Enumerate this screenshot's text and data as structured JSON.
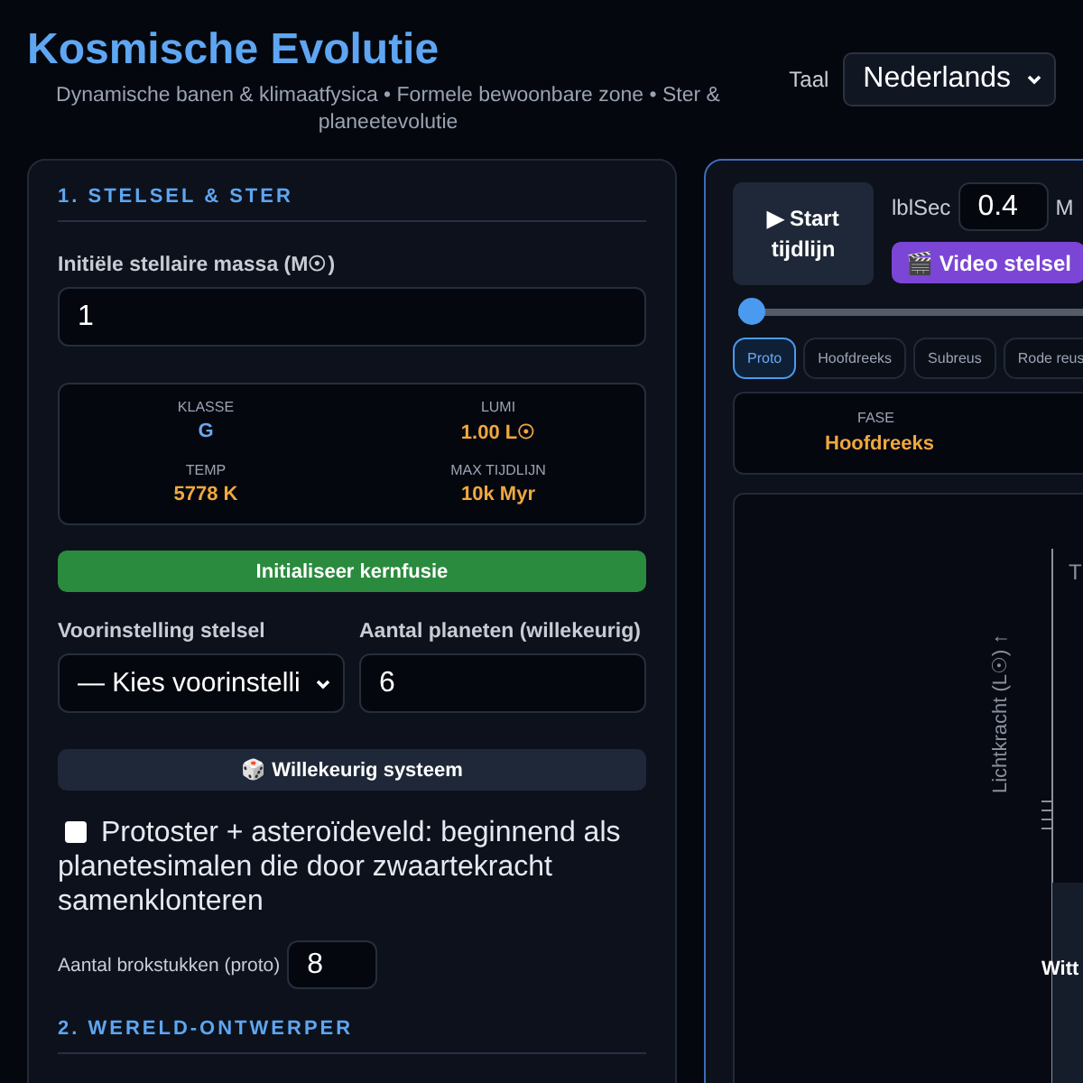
{
  "header": {
    "title": "Kosmische Evolutie",
    "subtitle": "Dynamische banen & klimaatfysica • Formele bewoonbare zone • Ster & planeetevolutie",
    "language": {
      "label": "Taal",
      "value": "Nederlands"
    }
  },
  "left_panel": {
    "section_1": "1. STELSEL & STER",
    "mass": {
      "label": "Initiële stellaire massa (M☉)",
      "value": "1"
    },
    "stats": [
      {
        "label": "KLASSE",
        "value": "G",
        "color": "#6aa8f0"
      },
      {
        "label": "LUMI",
        "value": "1.00 L☉",
        "color": "#f0a840"
      },
      {
        "label": "TEMP",
        "value": "5778 K",
        "color": "#f0a840"
      },
      {
        "label": "MAX TIJDLIJN",
        "value": "10k Myr",
        "color": "#f0a840"
      }
    ],
    "ignite_button": "Initialiseer kernfusie",
    "preset": {
      "label": "Voorinstelling stelsel",
      "value": "— Kies voorinstelli"
    },
    "planet_count": {
      "label": "Aantal planeten (willekeurig)",
      "value": "6"
    },
    "random_button": "🎲 Willekeurig systeem",
    "protostar": {
      "label": "Protoster + asteroïdeveld: beginnend als planetesimalen die door zwaartekracht samenklonteren",
      "checked": false
    },
    "fragments": {
      "label": "Aantal brokstukken (proto)",
      "value": "8"
    },
    "section_2": "2. WERELD-ONTWERPER"
  },
  "right_panel": {
    "start_button": "▶ Start tijdlijn",
    "speed": {
      "label": "lblSec",
      "value": "0.4"
    },
    "cut_label": "M",
    "video_button": "🎬 Video stelsel",
    "timeline": {
      "level": 0
    },
    "phase_tabs": [
      {
        "label": "Proto",
        "selected": true
      },
      {
        "label": "Hoofdreeks",
        "selected": false
      },
      {
        "label": "Subreus",
        "selected": false
      },
      {
        "label": "Rode reus",
        "selected": false
      }
    ],
    "phase": {
      "label": "FASE",
      "value": "Hoofdreeks"
    },
    "diagram": {
      "y_axis_label": "Lichtkracht (L☉) ↑",
      "top_label": "T",
      "region_label": "Witt"
    }
  }
}
